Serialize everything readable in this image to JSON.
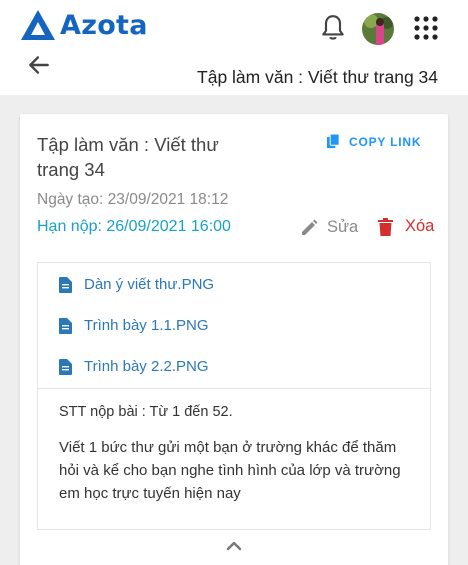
{
  "app": {
    "logo_text": "Azota"
  },
  "header": {
    "page_title": "Tập làm văn : Viết thư trang 34"
  },
  "assignment": {
    "title": "Tập làm văn : Viết thư trang 34",
    "copy_link_label": "COPY LINK",
    "created": "Ngày tạo: 23/09/2021 18:12",
    "deadline": "Hạn nộp: 26/09/2021 16:00",
    "edit_label": "Sửa",
    "delete_label": "Xóa",
    "files": [
      {
        "name": "Dàn ý viết thư.PNG"
      },
      {
        "name": "Trình bày 1.1.PNG"
      },
      {
        "name": "Trình bày 2.2.PNG"
      }
    ],
    "stt": "STT nộp bài : Từ 1 đến 52.",
    "description": "Viết 1 bức thư gửi một bạn ở trường khác để thăm hỏi và kể cho bạn nghe tình hình của lớp và trường em học trực tuyến hiện nay"
  },
  "colors": {
    "brand": "#1565c0",
    "link": "#2196f3",
    "deadline": "#17a2c6",
    "delete": "#d32f2f",
    "file_link": "#2b78b8"
  },
  "icons": [
    "azota-logo-icon",
    "bell-icon",
    "avatar",
    "apps-grid-icon",
    "back-arrow-icon",
    "copy-icon",
    "pencil-icon",
    "trash-icon",
    "file-icon",
    "chevron-up-icon"
  ]
}
